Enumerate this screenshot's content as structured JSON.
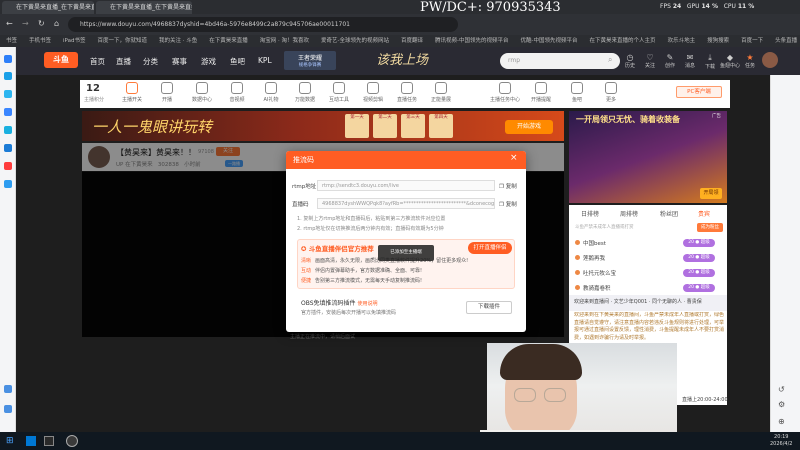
{
  "browser": {
    "tabs": [
      "在下黄昊来直播_在下黄昊来直播 斗鱼",
      "在下黄昊来直播_在下黄昊来直播 斗鱼"
    ],
    "url": "https://www.douyu.com/4968837dyshid=4bd46a-5976e8499c2a879c945706ae00011701",
    "bookmarks": [
      "书签",
      "手机书签",
      "iPad书签",
      "百度一下，你就知道",
      "我的关注 · 斗鱼",
      "在下黄昊来直播",
      "淘宝网 · 淘！我喜欢",
      "爱奇艺-全球领先的视频网站",
      "百度翻译",
      "腾讯视频-中国领先的视频平台",
      "优酷-中国领先视频平台",
      "在下黄昊来直播的个人主页",
      "欢乐斗地主",
      "搜狗搜索",
      "百度一下",
      "头条直播"
    ]
  },
  "overlay": {
    "watermark": "PW/DC+: 970935343",
    "fps_label": "FPS",
    "fps_value": "24",
    "gpu_label": "GPU",
    "gpu_value": "14 %",
    "cpu_label": "CPU",
    "cpu_value": "11 %"
  },
  "site": {
    "nav": [
      "首页",
      "直播",
      "分类",
      "赛事",
      "游戏",
      "鱼吧",
      "KPL"
    ],
    "header_badge": "王者荣耀",
    "header_badge_sub": "规格争锋赛",
    "search_placeholder": "rmp",
    "slogan": "该我上场",
    "header_icons": [
      "历史",
      "关注",
      "创作",
      "消息",
      "下载",
      "鱼翅中心",
      "任务"
    ]
  },
  "categories": {
    "level": "12",
    "level_label": "主播积分",
    "items": [
      "主播开关",
      "开播",
      "数据中心",
      "音视频",
      "AI礼物",
      "万能数据",
      "互动工具",
      "视频剪辑",
      "直播任务",
      "正能量展",
      "主播任务中心",
      "开播提醒",
      "鱼吧",
      "更多"
    ],
    "pc_button": "PC客户端"
  },
  "banner": {
    "title": "一人一鬼眼讲玩转",
    "button": "开始游戏",
    "cards": [
      "第一天",
      "第二天",
      "第三天",
      "第四天"
    ]
  },
  "room": {
    "title": "【黄昊来】黄昊来！！",
    "id_label": "97108",
    "follow": "关注",
    "sub": "UP 在下黄昊来",
    "viewers": "302838",
    "timestamp": "小时前",
    "badge": "一路播"
  },
  "modal": {
    "title": "推流码",
    "rtmp_label": "rtmp地址",
    "rtmp_value": "rtmp://sendtc3.douyu.com/live",
    "stream_label": "直播码",
    "stream_value": "4968837dyshWWQPqk8?ayfRb=*************************&dconecognition",
    "copy": "复制",
    "notes": [
      "1. 复制上方rtmp地址和直播码后，粘贴到第三方推流软件对应位置",
      "2. rtmp地址仅在切换推流后两分钟内有效；直播码有效期为5分钟"
    ],
    "promo_title": "斗鱼直播伴侣官方推荐",
    "promo_button": "打开直播伴侣",
    "tooltip": "已添加至主播端",
    "promo_rows": [
      {
        "tag": "清晰",
        "text": "画面高清，永久无限，画质比同类直播软件提升20%，留住更多观众!"
      },
      {
        "tag": "互动",
        "text": "伴侣内置弹幕助手，官方数据准确、全面、可靠!"
      },
      {
        "tag": "便捷",
        "text": "告别第三方推流模式，无需每天手动复制推流码!"
      }
    ],
    "obs_title": "OBS免填推流码插件",
    "obs_link": "使用说明",
    "obs_desc": "官方插件，安装后每次开播可以免填推流码",
    "obs_button": "下载插件"
  },
  "video": {
    "hint": "主播正在推流中，请稍后面试"
  },
  "right_ad": {
    "title": "一开局领只无忧、骑着收装备",
    "sub": "开局领",
    "ad_tag": "广告"
  },
  "right_panel": {
    "tabs": [
      "日排榜",
      "周排榜",
      "粉丝团",
      "贵宾"
    ],
    "promo": "斗鱼严禁未成年人直播或打赏",
    "join": "成为粉丝",
    "rows": [
      {
        "name": "中国best",
        "badge": "20 ● 超级"
      },
      {
        "name": "莲鹅再我",
        "badge": "20 ● 超级"
      },
      {
        "name": "吐托元牧么宝",
        "badge": "20 ● 超级"
      },
      {
        "name": "教骑嘉卷积",
        "badge": "20 ● 超级"
      }
    ],
    "chat_header": "欢迎来到直播间 · 文艺少年Q001 · 同个无聊的人 · 曹贵保",
    "chat_lines": [
      "欢迎来到在下黄昊来的直播间，斗鱼严禁未成年人直播或打赏，绿色直播请自觉遵守，请注意直播内容若违反斗鱼规则将进行处理，可举报可通过直播间设置反馈，理性消费，斗鱼提醒未成年人不要打赏消费，如遇到诈骗行为请及时举报。",
      "直播上20:00-24:00"
    ]
  },
  "taskbar": {
    "time": "20:19",
    "date": "2026/4/2"
  }
}
